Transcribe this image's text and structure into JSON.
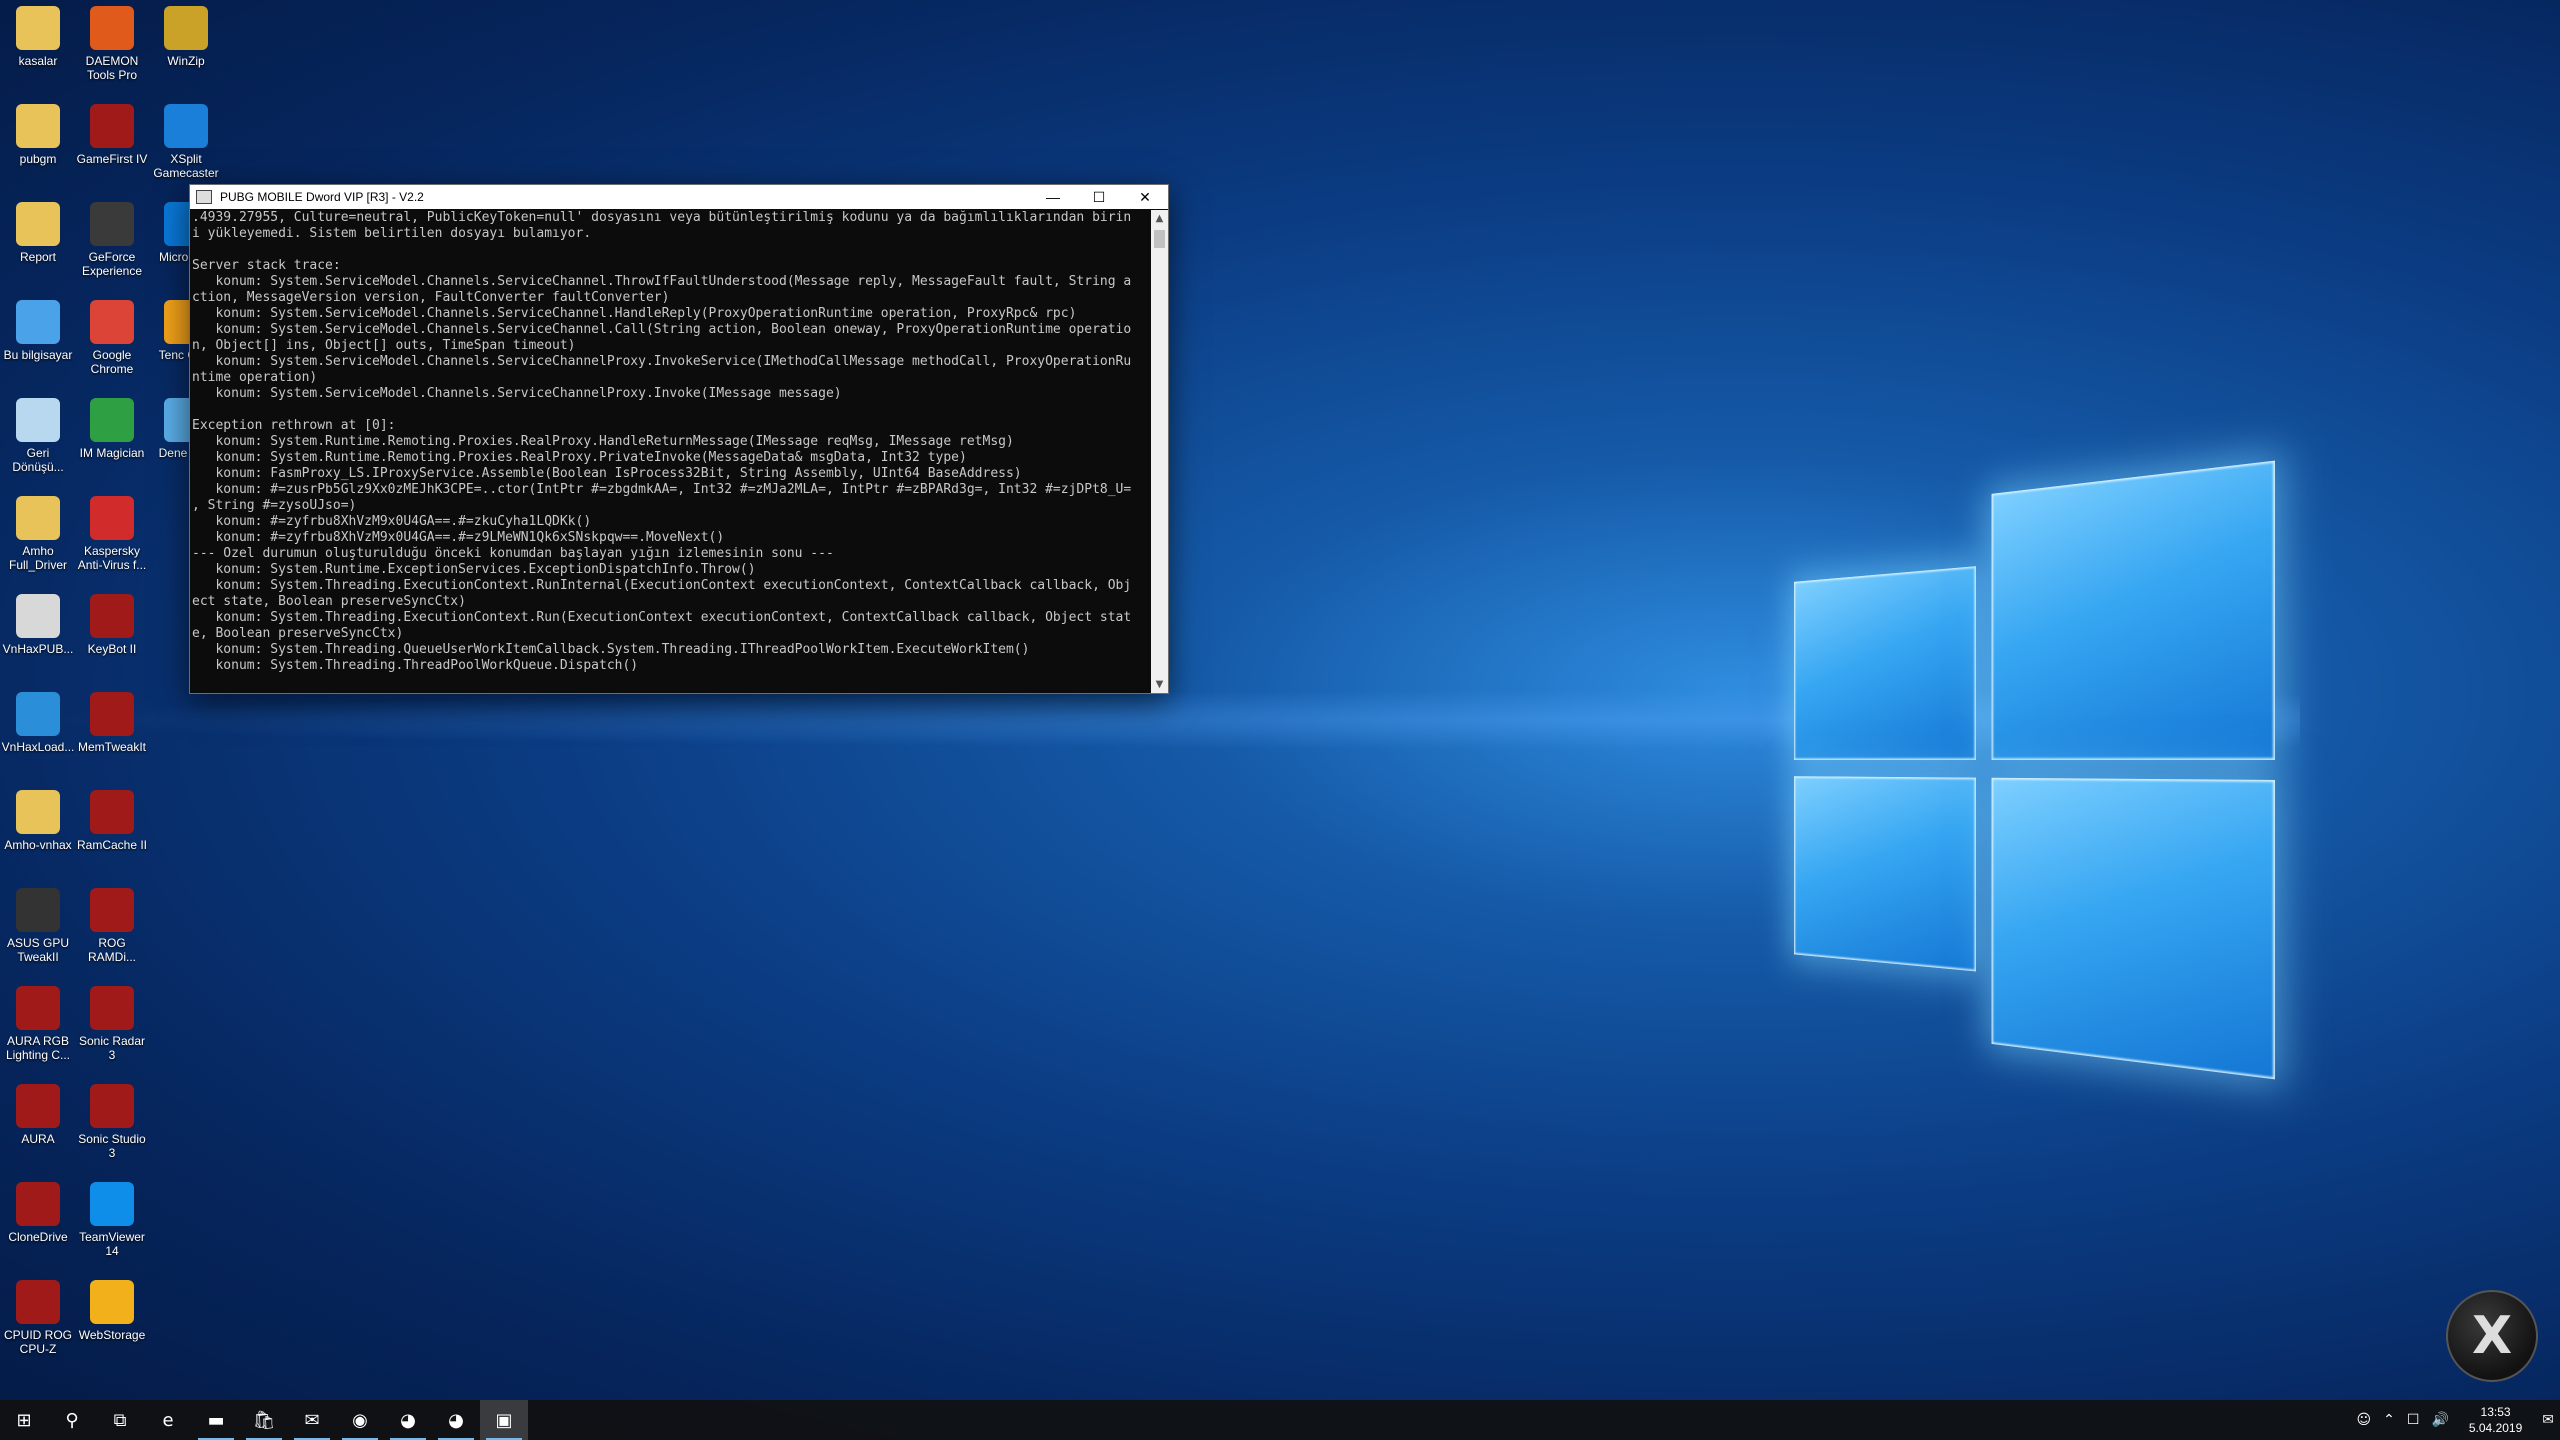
{
  "desktop": {
    "icons": [
      {
        "label": "kasalar",
        "icon": "folder-icon",
        "color": "#e8c35a"
      },
      {
        "label": "DAEMON Tools Pro",
        "icon": "daemon-tools-icon",
        "color": "#e05a1c"
      },
      {
        "label": "WinZip",
        "icon": "winzip-icon",
        "color": "#c9a227"
      },
      {
        "label": "pubgm",
        "icon": "folder-icon",
        "color": "#e8c35a"
      },
      {
        "label": "GameFirst IV",
        "icon": "gamefirst-icon",
        "color": "#a01a1a"
      },
      {
        "label": "XSplit Gamecaster",
        "icon": "xsplit-icon",
        "color": "#1a7fd8"
      },
      {
        "label": "Report",
        "icon": "folder-icon",
        "color": "#e8c35a"
      },
      {
        "label": "GeForce Experience",
        "icon": "geforce-icon",
        "color": "#3a3a3a"
      },
      {
        "label": "Micro Edg",
        "icon": "edge-icon",
        "color": "#0a78d7"
      },
      {
        "label": "Bu bilgisayar",
        "icon": "computer-icon",
        "color": "#4aa3e8"
      },
      {
        "label": "Google Chrome",
        "icon": "chrome-icon",
        "color": "#db4437"
      },
      {
        "label": "Tenc Gam",
        "icon": "tencent-icon",
        "color": "#f2a21a"
      },
      {
        "label": "Geri Dönüşü...",
        "icon": "recycle-bin-icon",
        "color": "#b8d8f0"
      },
      {
        "label": "IM Magician",
        "icon": "magician-icon",
        "color": "#2ea043"
      },
      {
        "label": "Dene Mas",
        "icon": "control-icon",
        "color": "#5aaee8"
      },
      {
        "label": "Amho Full_Driver",
        "icon": "folder-icon",
        "color": "#e8c35a"
      },
      {
        "label": "Kaspersky Anti-Virus f...",
        "icon": "kaspersky-icon",
        "color": "#d12b2b"
      },
      {
        "label": "VnHaxPUB...",
        "icon": "file-icon",
        "color": "#d8d8d8"
      },
      {
        "label": "KeyBot II",
        "icon": "keybot-icon",
        "color": "#a01a1a"
      },
      {
        "label": "VnHaxLoad...",
        "icon": "vnhax-icon",
        "color": "#2a8fd8"
      },
      {
        "label": "MemTweakIt",
        "icon": "memtweak-icon",
        "color": "#a01a1a"
      },
      {
        "label": "Amho-vnhax",
        "icon": "folder-icon",
        "color": "#e8c35a"
      },
      {
        "label": "RamCache II",
        "icon": "ramcache-icon",
        "color": "#a01a1a"
      },
      {
        "label": "ASUS GPU TweakII",
        "icon": "gpu-tweak-icon",
        "color": "#333333"
      },
      {
        "label": "ROG RAMDi...",
        "icon": "rog-icon",
        "color": "#a01a1a"
      },
      {
        "label": "AURA RGB Lighting C...",
        "icon": "aura-icon",
        "color": "#a01a1a"
      },
      {
        "label": "Sonic Radar 3",
        "icon": "sonic-radar-icon",
        "color": "#a01a1a"
      },
      {
        "label": "AURA",
        "icon": "aura-icon",
        "color": "#a01a1a"
      },
      {
        "label": "Sonic Studio 3",
        "icon": "sonic-studio-icon",
        "color": "#a01a1a"
      },
      {
        "label": "CloneDrive",
        "icon": "clonedrive-icon",
        "color": "#a01a1a"
      },
      {
        "label": "TeamViewer 14",
        "icon": "teamviewer-icon",
        "color": "#0e8ee9"
      },
      {
        "label": "CPUID ROG CPU-Z",
        "icon": "cpuz-icon",
        "color": "#a01a1a"
      },
      {
        "label": "WebStorage",
        "icon": "webstorage-icon",
        "color": "#f2b01a"
      }
    ]
  },
  "console": {
    "title": "PUBG MOBILE Dword VIP [R3] - V2.2",
    "lines": [
      ".4939.27955, Culture=neutral, PublicKeyToken=null' dosyasını veya bütünleştirilmiş kodunu ya da bağımlılıklarından birin",
      "i yükleyemedi. Sistem belirtilen dosyayı bulamıyor.",
      "",
      "Server stack trace:",
      "   konum: System.ServiceModel.Channels.ServiceChannel.ThrowIfFaultUnderstood(Message reply, MessageFault fault, String a",
      "ction, MessageVersion version, FaultConverter faultConverter)",
      "   konum: System.ServiceModel.Channels.ServiceChannel.HandleReply(ProxyOperationRuntime operation, ProxyRpc& rpc)",
      "   konum: System.ServiceModel.Channels.ServiceChannel.Call(String action, Boolean oneway, ProxyOperationRuntime operatio",
      "n, Object[] ins, Object[] outs, TimeSpan timeout)",
      "   konum: System.ServiceModel.Channels.ServiceChannelProxy.InvokeService(IMethodCallMessage methodCall, ProxyOperationRu",
      "ntime operation)",
      "   konum: System.ServiceModel.Channels.ServiceChannelProxy.Invoke(IMessage message)",
      "",
      "Exception rethrown at [0]:",
      "   konum: System.Runtime.Remoting.Proxies.RealProxy.HandleReturnMessage(IMessage reqMsg, IMessage retMsg)",
      "   konum: System.Runtime.Remoting.Proxies.RealProxy.PrivateInvoke(MessageData& msgData, Int32 type)",
      "   konum: FasmProxy_LS.IProxyService.Assemble(Boolean IsProcess32Bit, String Assembly, UInt64 BaseAddress)",
      "   konum: #=zusrPb5Glz9Xx0zMEJhK3CPE=..ctor(IntPtr #=zbgdmkAA=, Int32 #=zMJa2MLA=, IntPtr #=zBPARd3g=, Int32 #=zjDPt8_U=",
      ", String #=zysoUJso=)",
      "   konum: #=zyfrbu8XhVzM9x0U4GA==.#=zkuCyha1LQDKk()",
      "   konum: #=zyfrbu8XhVzM9x0U4GA==.#=z9LMeWN1Qk6xSNskpqw==.MoveNext()",
      "--- Özel durumun oluşturulduğu önceki konumdan başlayan yığın izlemesinin sonu ---",
      "   konum: System.Runtime.ExceptionServices.ExceptionDispatchInfo.Throw()",
      "   konum: System.Threading.ExecutionContext.RunInternal(ExecutionContext executionContext, ContextCallback callback, Obj",
      "ect state, Boolean preserveSyncCtx)",
      "   konum: System.Threading.ExecutionContext.Run(ExecutionContext executionContext, ContextCallback callback, Object stat",
      "e, Boolean preserveSyncCtx)",
      "   konum: System.Threading.QueueUserWorkItemCallback.System.Threading.IThreadPoolWorkItem.ExecuteWorkItem()",
      "   konum: System.Threading.ThreadPoolWorkQueue.Dispatch()"
    ]
  },
  "taskbar": {
    "buttons": [
      {
        "name": "start-button",
        "icon": "windows-icon",
        "glyph": "⊞"
      },
      {
        "name": "search-button",
        "icon": "search-icon",
        "glyph": "⚲"
      },
      {
        "name": "task-view-button",
        "icon": "task-view-icon",
        "glyph": "⧉"
      },
      {
        "name": "edge-button",
        "icon": "edge-icon",
        "glyph": "e"
      },
      {
        "name": "file-explorer-button",
        "icon": "folder-icon",
        "glyph": "▬"
      },
      {
        "name": "store-button",
        "icon": "store-icon",
        "glyph": "🛍"
      },
      {
        "name": "mail-button",
        "icon": "mail-icon",
        "glyph": "✉"
      },
      {
        "name": "chrome-button",
        "icon": "chrome-icon",
        "glyph": "◉"
      },
      {
        "name": "browser-button-1",
        "icon": "browser-icon",
        "glyph": "◕"
      },
      {
        "name": "browser-button-2",
        "icon": "browser-icon",
        "glyph": "◕"
      },
      {
        "name": "console-button",
        "icon": "console-icon",
        "glyph": "▣"
      }
    ],
    "tray": {
      "time": "13:53",
      "date": "5.04.2019"
    }
  },
  "widget": {
    "glyph": "X"
  },
  "colors": {
    "accent": "#76b9ed",
    "console_bg": "#0c0c0c",
    "console_fg": "#c8c8c8"
  }
}
